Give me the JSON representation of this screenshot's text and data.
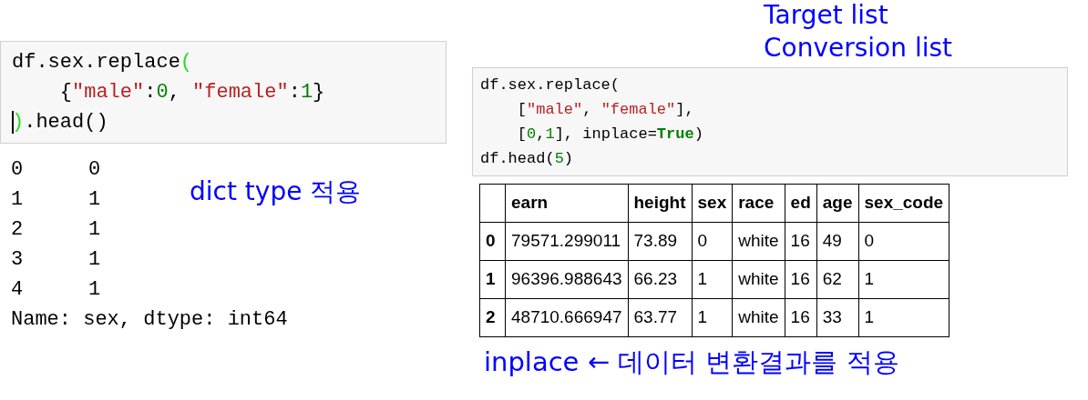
{
  "left": {
    "code_cell": {
      "lines": [
        {
          "cursor": false,
          "tokens": [
            {
              "kind": "plain",
              "text": "df.sex.replace"
            },
            {
              "kind": "match",
              "text": "("
            }
          ]
        },
        {
          "cursor": false,
          "tokens": [
            {
              "kind": "plain",
              "text": "    {"
            },
            {
              "kind": "string",
              "text": "\"male\""
            },
            {
              "kind": "plain",
              "text": ":"
            },
            {
              "kind": "number",
              "text": "0"
            },
            {
              "kind": "plain",
              "text": ", "
            },
            {
              "kind": "string",
              "text": "\"female\""
            },
            {
              "kind": "plain",
              "text": ":"
            },
            {
              "kind": "number",
              "text": "1"
            },
            {
              "kind": "plain",
              "text": "}"
            }
          ]
        },
        {
          "cursor": true,
          "tokens": [
            {
              "kind": "match",
              "text": ")"
            },
            {
              "kind": "plain",
              "text": ".head()"
            }
          ]
        }
      ]
    },
    "output": {
      "rows": [
        [
          "0",
          "0"
        ],
        [
          "1",
          "1"
        ],
        [
          "2",
          "1"
        ],
        [
          "3",
          "1"
        ],
        [
          "4",
          "1"
        ]
      ],
      "footer": "Name: sex, dtype: int64"
    },
    "note": "dict type 적용"
  },
  "right": {
    "annotations": [
      "Target list",
      "Conversion list"
    ],
    "code_cell": {
      "lines": [
        {
          "cursor": false,
          "tokens": [
            {
              "kind": "plain",
              "text": "df.sex.replace("
            }
          ]
        },
        {
          "cursor": false,
          "tokens": [
            {
              "kind": "plain",
              "text": "    ["
            },
            {
              "kind": "string",
              "text": "\"male\""
            },
            {
              "kind": "plain",
              "text": ", "
            },
            {
              "kind": "string",
              "text": "\"female\""
            },
            {
              "kind": "plain",
              "text": "],"
            }
          ]
        },
        {
          "cursor": false,
          "tokens": [
            {
              "kind": "plain",
              "text": "    ["
            },
            {
              "kind": "number",
              "text": "0"
            },
            {
              "kind": "plain",
              "text": ","
            },
            {
              "kind": "number",
              "text": "1"
            },
            {
              "kind": "plain",
              "text": "], inplace="
            },
            {
              "kind": "keyword",
              "text": "True"
            },
            {
              "kind": "plain",
              "text": ")"
            }
          ]
        },
        {
          "cursor": false,
          "tokens": [
            {
              "kind": "plain",
              "text": "df.head("
            },
            {
              "kind": "number",
              "text": "5"
            },
            {
              "kind": "plain",
              "text": ")"
            }
          ]
        }
      ]
    },
    "table": {
      "columns": [
        "earn",
        "height",
        "sex",
        "race",
        "ed",
        "age",
        "sex_code"
      ],
      "rows": [
        {
          "index": "0",
          "cells": [
            "79571.299011",
            "73.89",
            "0",
            "white",
            "16",
            "49",
            "0"
          ]
        },
        {
          "index": "1",
          "cells": [
            "96396.988643",
            "66.23",
            "1",
            "white",
            "16",
            "62",
            "1"
          ]
        },
        {
          "index": "2",
          "cells": [
            "48710.666947",
            "63.77",
            "1",
            "white",
            "16",
            "33",
            "1"
          ]
        }
      ]
    },
    "note": "inplace ← 데이터 변환결과를 적용"
  }
}
